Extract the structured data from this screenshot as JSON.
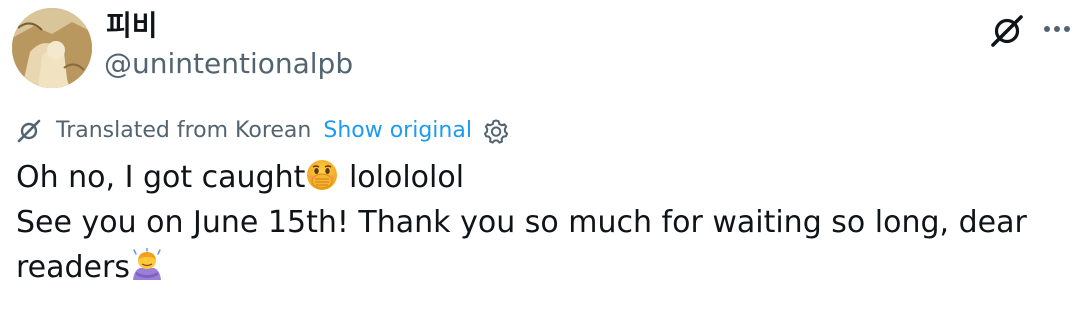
{
  "author": {
    "display_name": "피비",
    "handle": "@unintentionalpb",
    "avatar_icon": "profile-avatar"
  },
  "header_actions": {
    "grok_icon": "grok-icon",
    "more_icon": "more-options-icon"
  },
  "translation": {
    "icon": "translate-icon",
    "label": "Translated from Korean",
    "show_original_label": "Show original",
    "settings_icon": "gear-icon"
  },
  "tweet": {
    "line1_text": "Oh no, I got caught",
    "line1_emoji": "face-with-hand-over-mouth-emoji",
    "line1_suffix": " lolololol",
    "line2_text": "See you on June 15th! Thank you so much for waiting so long, dear",
    "line3_text": "readers",
    "line3_emoji": "person-bowing-emoji"
  },
  "colors": {
    "text_primary": "#0f1419",
    "text_secondary": "#536471",
    "link": "#1d9bf0",
    "background": "#ffffff"
  }
}
